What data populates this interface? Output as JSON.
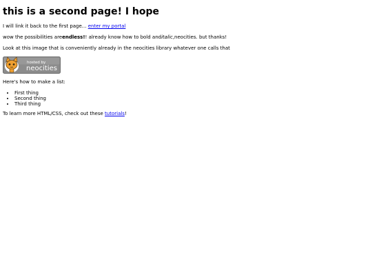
{
  "page": {
    "heading": "this is a second page! I hope",
    "p1": {
      "text": "I will link it back to the first page... ",
      "link": "enter my portal"
    },
    "p2": {
      "before": "wow the possibilities are",
      "bold": "endless!",
      "middle": "! already know how to bold and",
      "italic": "italic",
      "after": ",neocities. but thanks!"
    },
    "p3": "Look at this image that is conveniently already in the neocities library whatever one calls that",
    "badge": {
      "small": "hosted by",
      "big": "neocities"
    },
    "p4": "Here's how to make a list:",
    "list": [
      "First thing",
      "Second thing",
      "Third thing"
    ],
    "p5": {
      "before": "To learn more HTML/CSS, check out these ",
      "link": "tutorials",
      "after": "!"
    }
  },
  "colors": {
    "link": "#0000ee",
    "badge_bg": "#8c8c8c",
    "badge_cat": "#f0a030"
  },
  "icons": {
    "badge_mascot": "neocities-cat-icon"
  }
}
